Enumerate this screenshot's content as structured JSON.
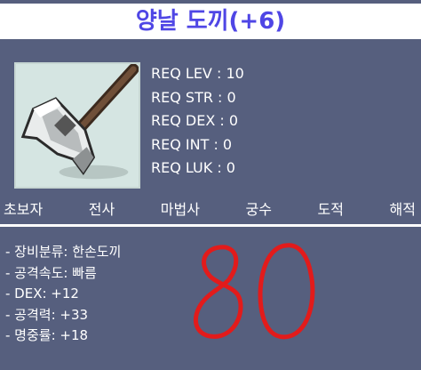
{
  "item": {
    "name": "양날 도끼(+6)",
    "icon": "double-axe-icon"
  },
  "requirements": [
    "REQ LEV : 10",
    "REQ STR : 0",
    "REQ DEX : 0",
    "REQ INT : 0",
    "REQ LUK : 0"
  ],
  "jobs": [
    "초보자",
    "전사",
    "마법사",
    "궁수",
    "도적",
    "해적"
  ],
  "stats": [
    "- 장비분류: 한손도끼",
    "- 공격속도: 빠름",
    "- DEX: +12",
    "- 공격력: +33",
    "- 명중률: +18"
  ],
  "annotation": {
    "text": "80",
    "color": "#e21b1b"
  },
  "colors": {
    "background": "#565f7e",
    "title_text": "#4f46e5",
    "title_bg": "#ffffff",
    "icon_bg": "#d5e5e2"
  }
}
